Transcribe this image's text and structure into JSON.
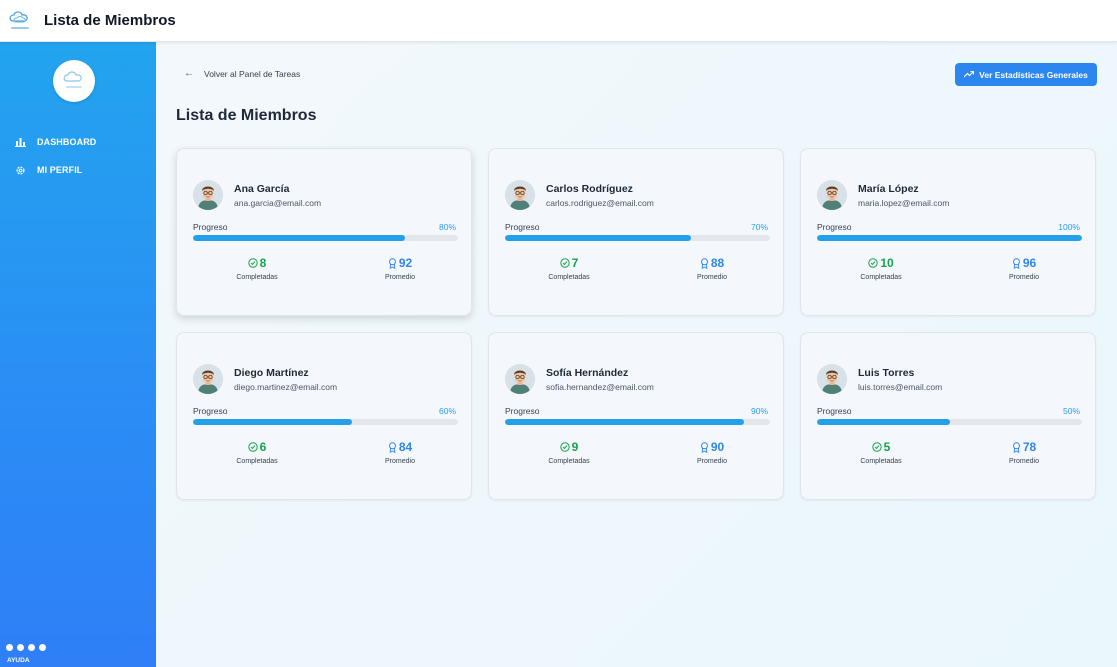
{
  "app": {
    "title": "Lista de Miembros"
  },
  "sidebar": {
    "items": [
      {
        "label": "DASHBOARD",
        "icon": "bar-chart-icon"
      },
      {
        "label": "MI PERFIL",
        "icon": "gear-icon"
      }
    ],
    "help_label": "AYUDA"
  },
  "main": {
    "back_label": "Volver al Panel de Tareas",
    "stats_button": "Ver Estadísticas Generales",
    "page_title": "Lista de Miembros",
    "progress_label": "Progreso",
    "completed_label": "Completadas",
    "average_label": "Promedio"
  },
  "members": [
    {
      "name": "Ana García",
      "email": "ana.garcia@email.com",
      "progress": 80,
      "progress_label": "80%",
      "completed": "8",
      "average": "92"
    },
    {
      "name": "Carlos Rodríguez",
      "email": "carlos.rodriguez@email.com",
      "progress": 70,
      "progress_label": "70%",
      "completed": "7",
      "average": "88"
    },
    {
      "name": "María López",
      "email": "maria.lopez@email.com",
      "progress": 100,
      "progress_label": "100%",
      "completed": "10",
      "average": "96"
    },
    {
      "name": "Diego Martínez",
      "email": "diego.martinez@email.com",
      "progress": 60,
      "progress_label": "60%",
      "completed": "6",
      "average": "84"
    },
    {
      "name": "Sofía Hernández",
      "email": "sofia.hernandez@email.com",
      "progress": 90,
      "progress_label": "90%",
      "completed": "9",
      "average": "90"
    },
    {
      "name": "Luis Torres",
      "email": "luis.torres@email.com",
      "progress": 50,
      "progress_label": "50%",
      "completed": "5",
      "average": "78"
    }
  ],
  "colors": {
    "sidebar_top": "#22a4ee",
    "sidebar_bottom": "#2f7ff6",
    "accent": "#2c86f0",
    "progress": "#24a0ea",
    "completed": "#16a34a",
    "average": "#2f86e8"
  }
}
